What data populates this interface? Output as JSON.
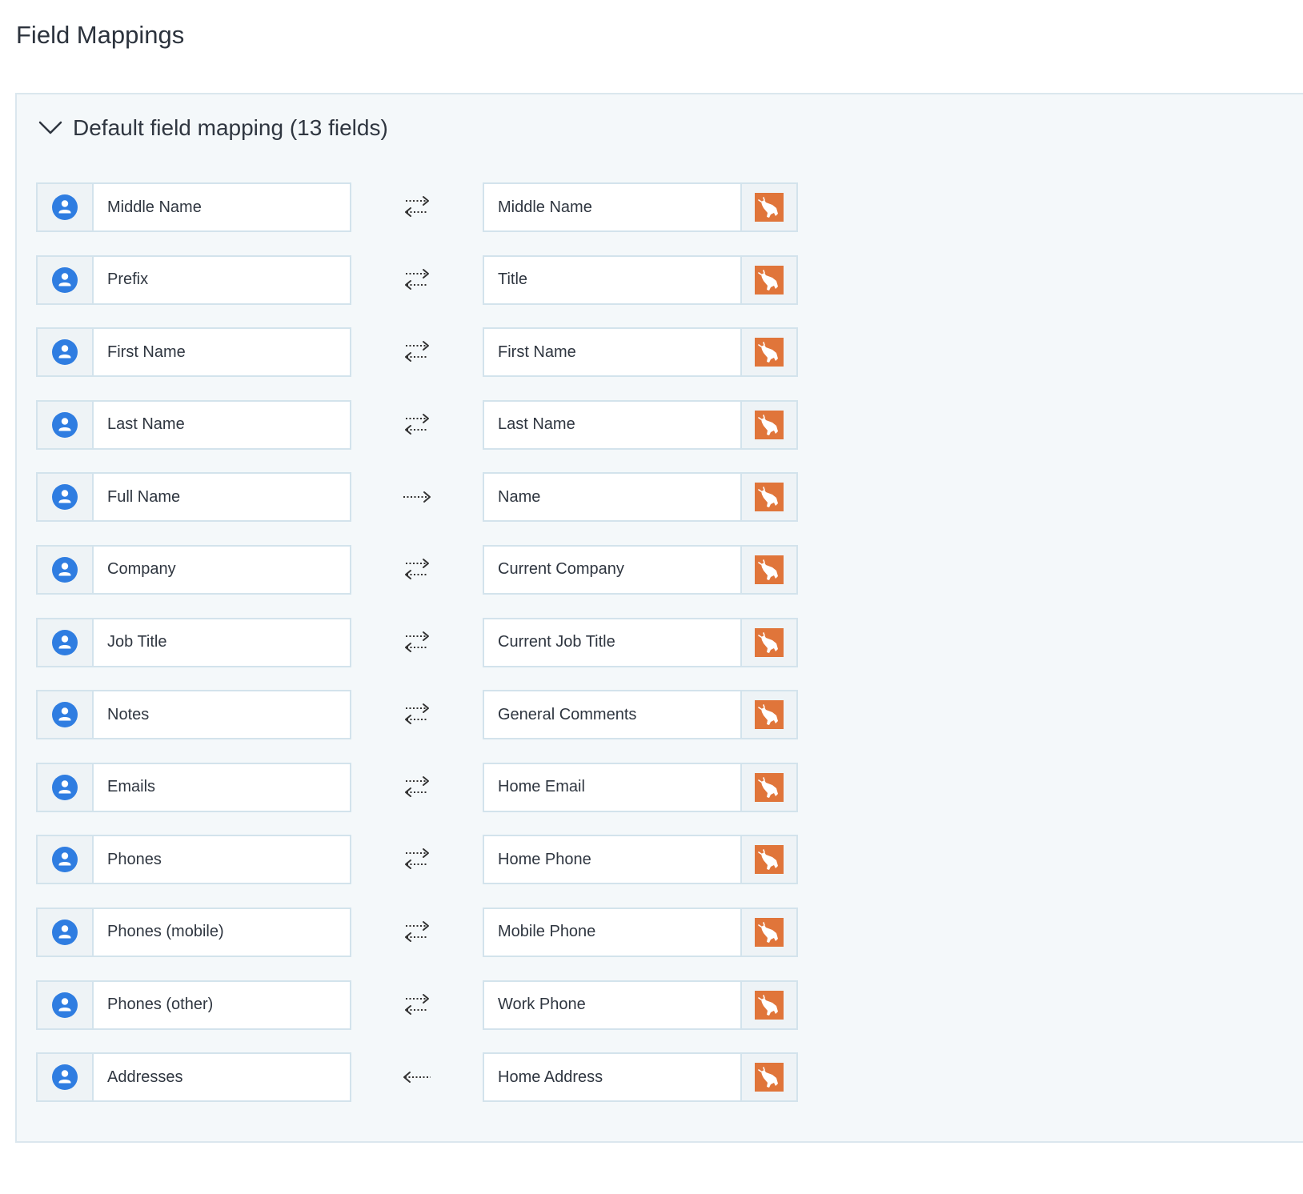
{
  "page": {
    "title": "Field Mappings"
  },
  "section": {
    "title": "Default field mapping (13 fields)",
    "expanded": true
  },
  "colors": {
    "person_icon": "#2f7de1",
    "brand_icon": "#e0753a",
    "panel_bg": "#f4f8fa",
    "border": "#d3e3ec"
  },
  "mappings": [
    {
      "source": "Middle Name",
      "target": "Middle Name",
      "direction": "both"
    },
    {
      "source": "Prefix",
      "target": "Title",
      "direction": "both"
    },
    {
      "source": "First Name",
      "target": "First Name",
      "direction": "both"
    },
    {
      "source": "Last Name",
      "target": "Last Name",
      "direction": "both"
    },
    {
      "source": "Full Name",
      "target": "Name",
      "direction": "to-target"
    },
    {
      "source": "Company",
      "target": "Current Company",
      "direction": "both"
    },
    {
      "source": "Job Title",
      "target": "Current Job Title",
      "direction": "both"
    },
    {
      "source": "Notes",
      "target": "General Comments",
      "direction": "both"
    },
    {
      "source": "Emails",
      "target": "Home Email",
      "direction": "both"
    },
    {
      "source": "Phones",
      "target": "Home Phone",
      "direction": "both"
    },
    {
      "source": "Phones (mobile)",
      "target": "Mobile Phone",
      "direction": "both"
    },
    {
      "source": "Phones (other)",
      "target": "Work Phone",
      "direction": "both"
    },
    {
      "source": "Addresses",
      "target": "Home Address",
      "direction": "to-source"
    }
  ],
  "icons": {
    "source": "person-circle-icon",
    "target": "bull-logo-icon",
    "both": "two-way-arrows-icon",
    "to-target": "arrow-right-icon",
    "to-source": "arrow-left-icon",
    "collapse": "chevron-down-icon"
  }
}
